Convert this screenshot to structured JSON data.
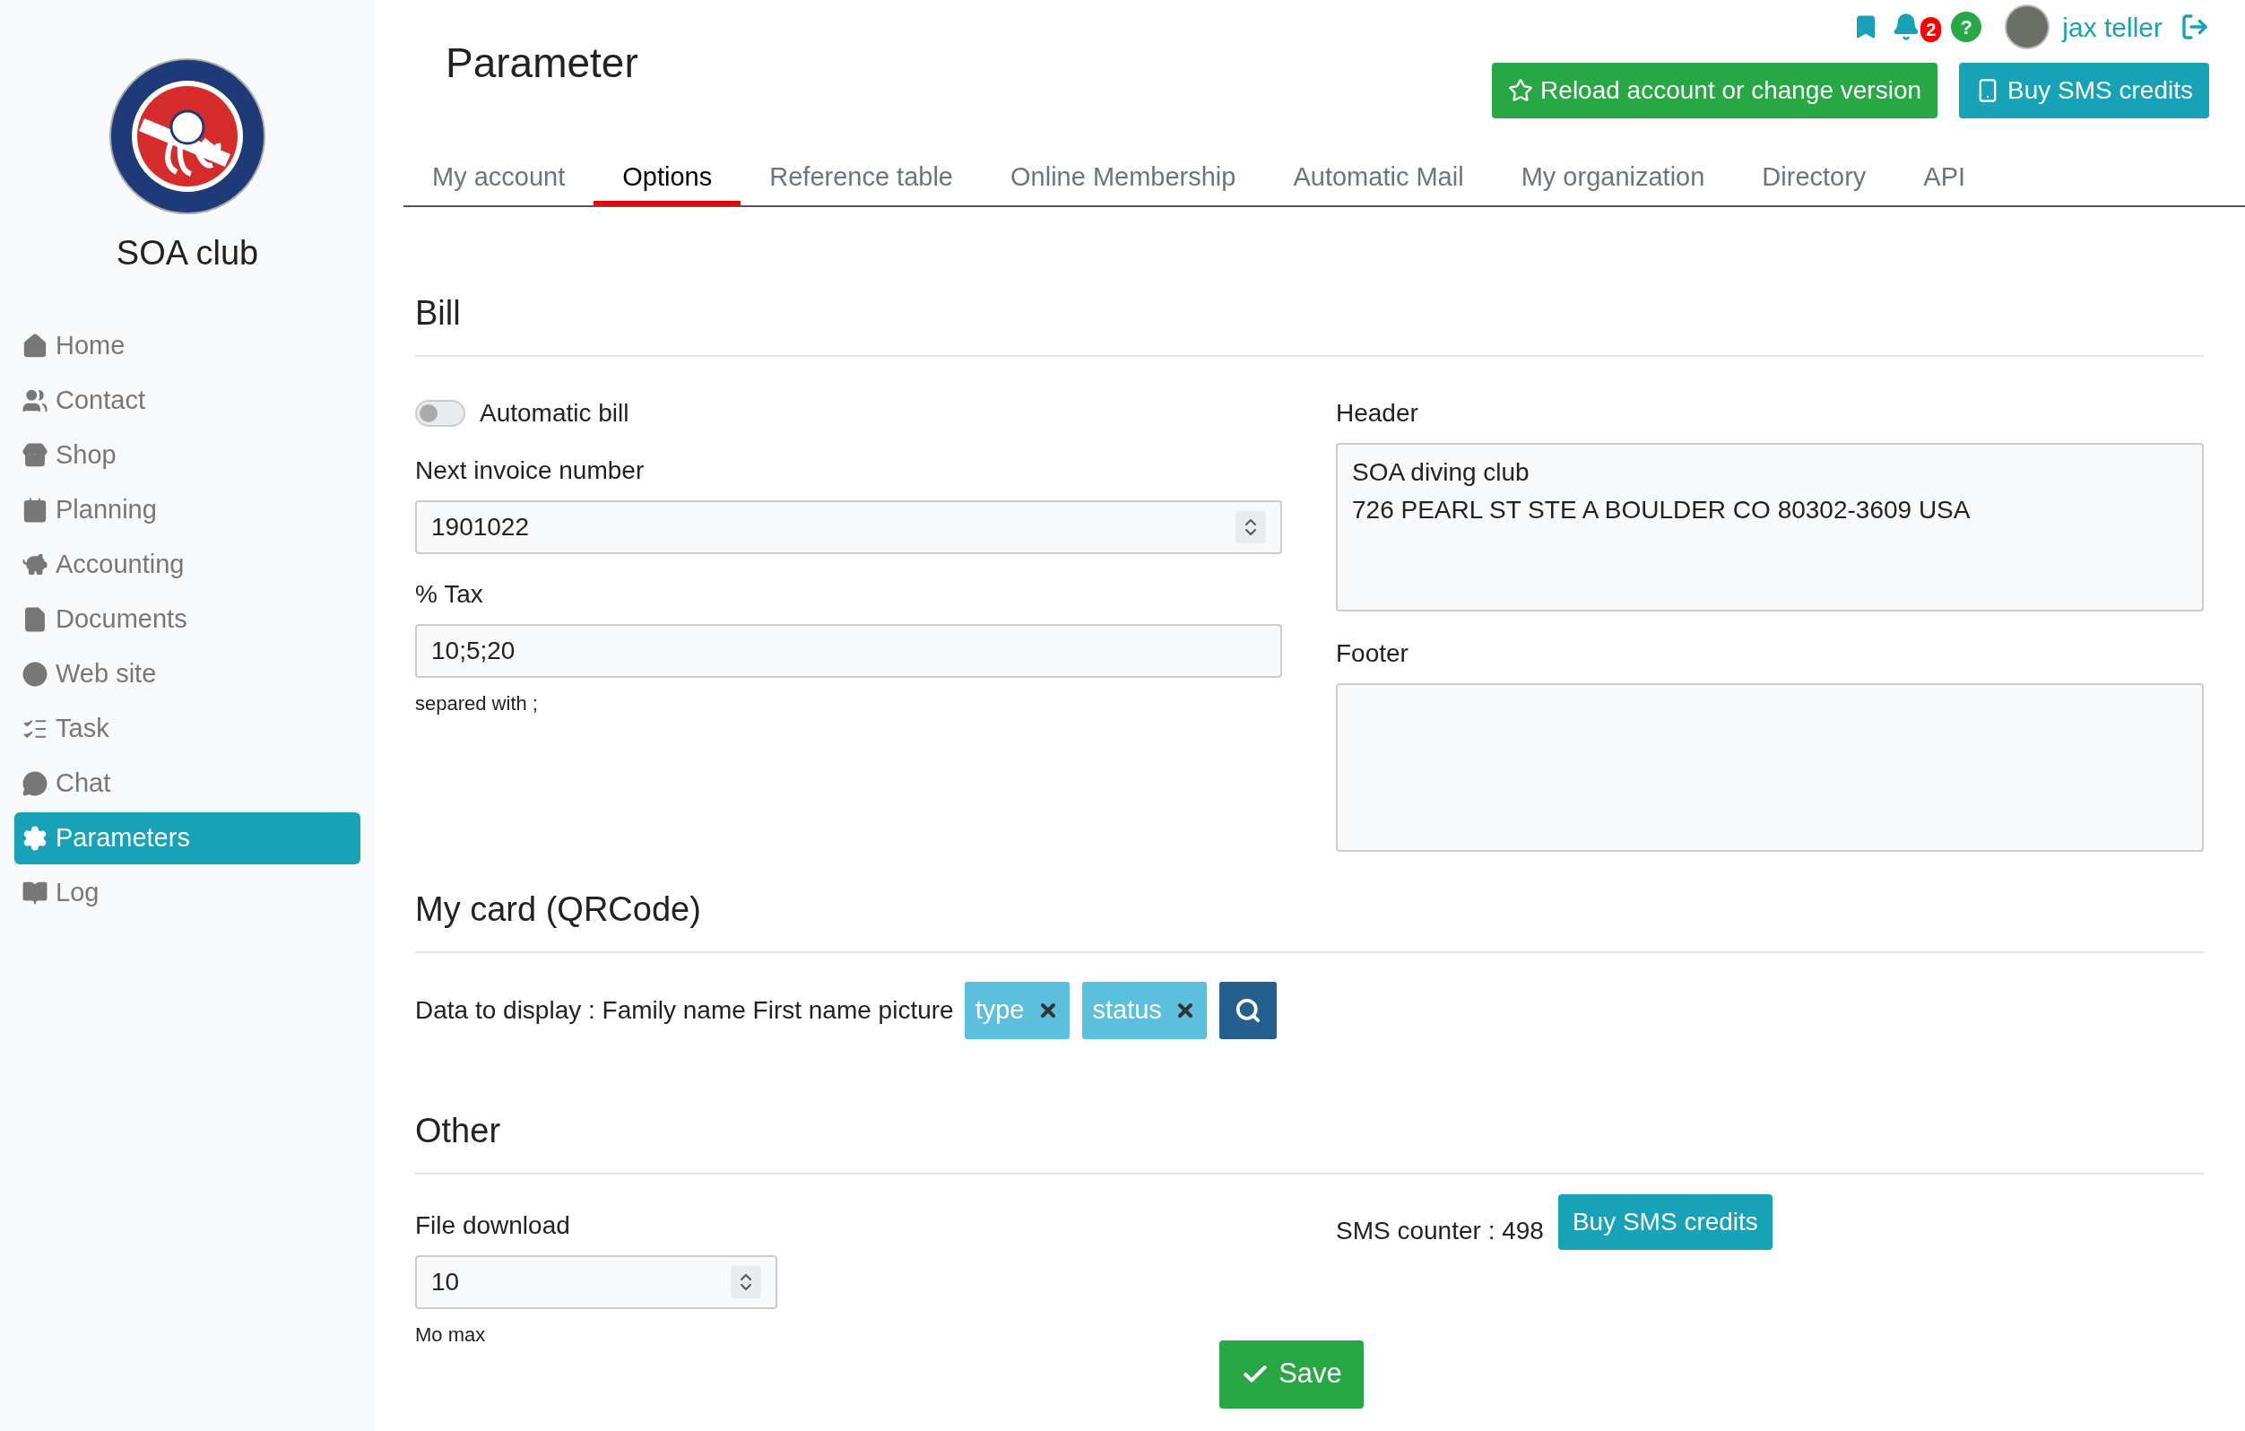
{
  "sidebar": {
    "club_name": "SOA club",
    "items": [
      {
        "label": "Home",
        "selected": false
      },
      {
        "label": "Contact",
        "selected": false
      },
      {
        "label": "Shop",
        "selected": false
      },
      {
        "label": "Planning",
        "selected": false
      },
      {
        "label": "Accounting",
        "selected": false
      },
      {
        "label": "Documents",
        "selected": false
      },
      {
        "label": "Web site",
        "selected": false
      },
      {
        "label": "Task",
        "selected": false
      },
      {
        "label": "Chat",
        "selected": false
      },
      {
        "label": "Parameters",
        "selected": true
      },
      {
        "label": "Log",
        "selected": false
      }
    ]
  },
  "header": {
    "title": "Parameter",
    "notification_count": "2",
    "help_badge": "?",
    "user_name": "jax teller",
    "buttons": [
      "Reload account or change version",
      "Buy SMS credits"
    ]
  },
  "tabs": [
    {
      "label": "My account",
      "selected": false
    },
    {
      "label": "Options",
      "selected": true
    },
    {
      "label": "Reference table",
      "selected": false
    },
    {
      "label": "Online Membership",
      "selected": false
    },
    {
      "label": "Automatic Mail",
      "selected": false
    },
    {
      "label": "My organization",
      "selected": false
    },
    {
      "label": "Directory",
      "selected": false
    },
    {
      "label": "API",
      "selected": false
    }
  ],
  "bill": {
    "heading": "Bill",
    "automatic_bill": {
      "label": "Automatic bill",
      "on": false
    },
    "next_invoice_number": {
      "label": "Next invoice number",
      "value": "1901022"
    },
    "tax": {
      "label": "% Tax",
      "value": "10;5;20",
      "hint": "separed with ;"
    },
    "header": {
      "label": "Header",
      "lines": [
        "SOA diving club",
        "726 PEARL ST STE A BOULDER CO 80302-3609 USA"
      ]
    },
    "footer": {
      "label": "Footer"
    }
  },
  "my_card": {
    "heading": "My card (QRCode)",
    "data_label": "Data to display : Family name First name picture",
    "tags": [
      "type",
      "status"
    ]
  },
  "other": {
    "heading": "Other",
    "file_download": {
      "label": "File download",
      "value": "10",
      "hint": "Mo max"
    },
    "sms_counter": "SMS counter : 498",
    "sms_button": "Buy SMS credits"
  },
  "save_button": "Save"
}
